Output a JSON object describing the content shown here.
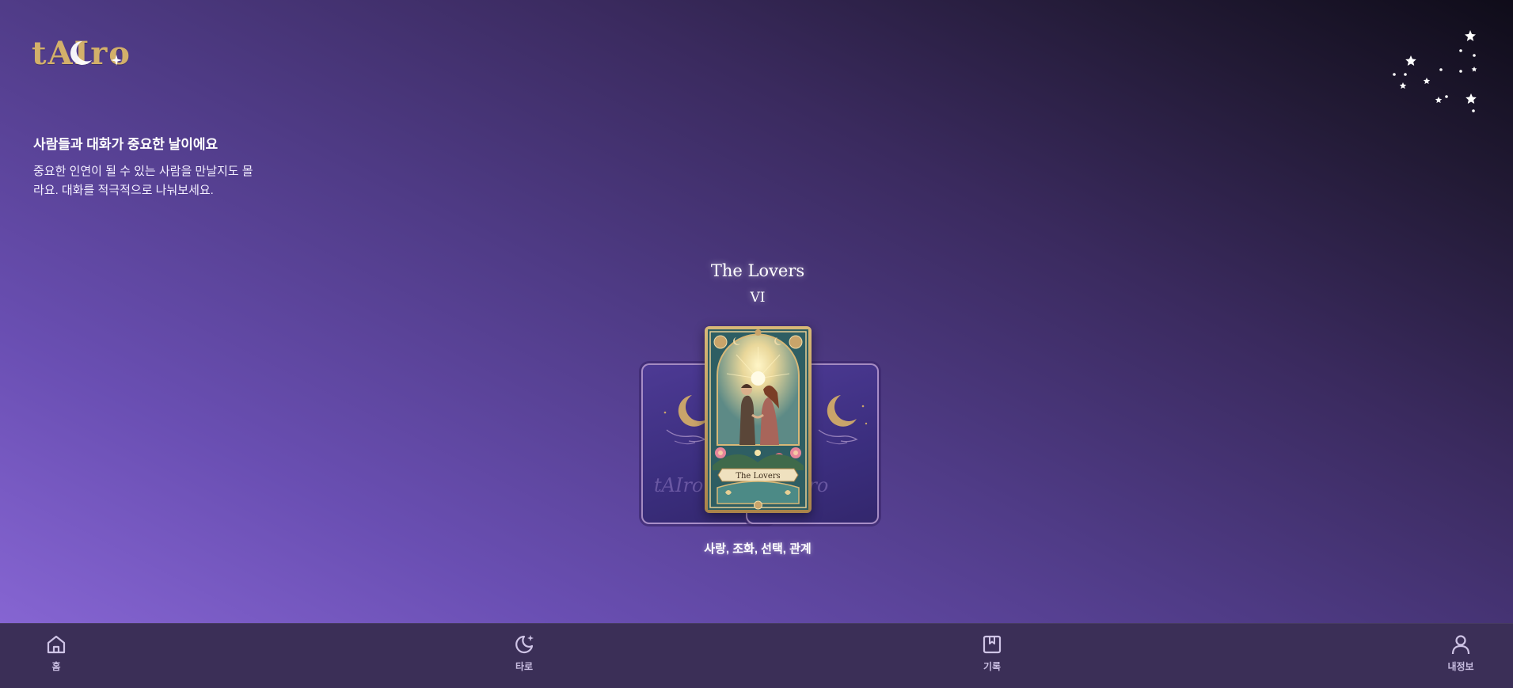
{
  "app": {
    "logo_text": "tAIro"
  },
  "fortune": {
    "headline": "사람들과 대화가 중요한 날이에요",
    "body_line1": "중요한 인연이 될 수 있는 사람을 만날지도 몰",
    "body_line2": "라요. 대화를 적극적으로 나눠보세요."
  },
  "card": {
    "name": "The Lovers",
    "numeral": "VI",
    "banner": "The Lovers",
    "keywords": "사랑, 조화, 선택, 관계",
    "back_signature": "tAIro"
  },
  "bottom_nav": {
    "items": [
      {
        "label": "홈",
        "icon": "home-icon"
      },
      {
        "label": "타로",
        "icon": "moon-star-icon"
      },
      {
        "label": "기록",
        "icon": "bookmark-icon"
      },
      {
        "label": "내정보",
        "icon": "user-icon"
      }
    ]
  },
  "colors": {
    "logo_gold": "#d3b06a",
    "nav_bg": "#3b2f57",
    "text_white": "#ffffff"
  }
}
